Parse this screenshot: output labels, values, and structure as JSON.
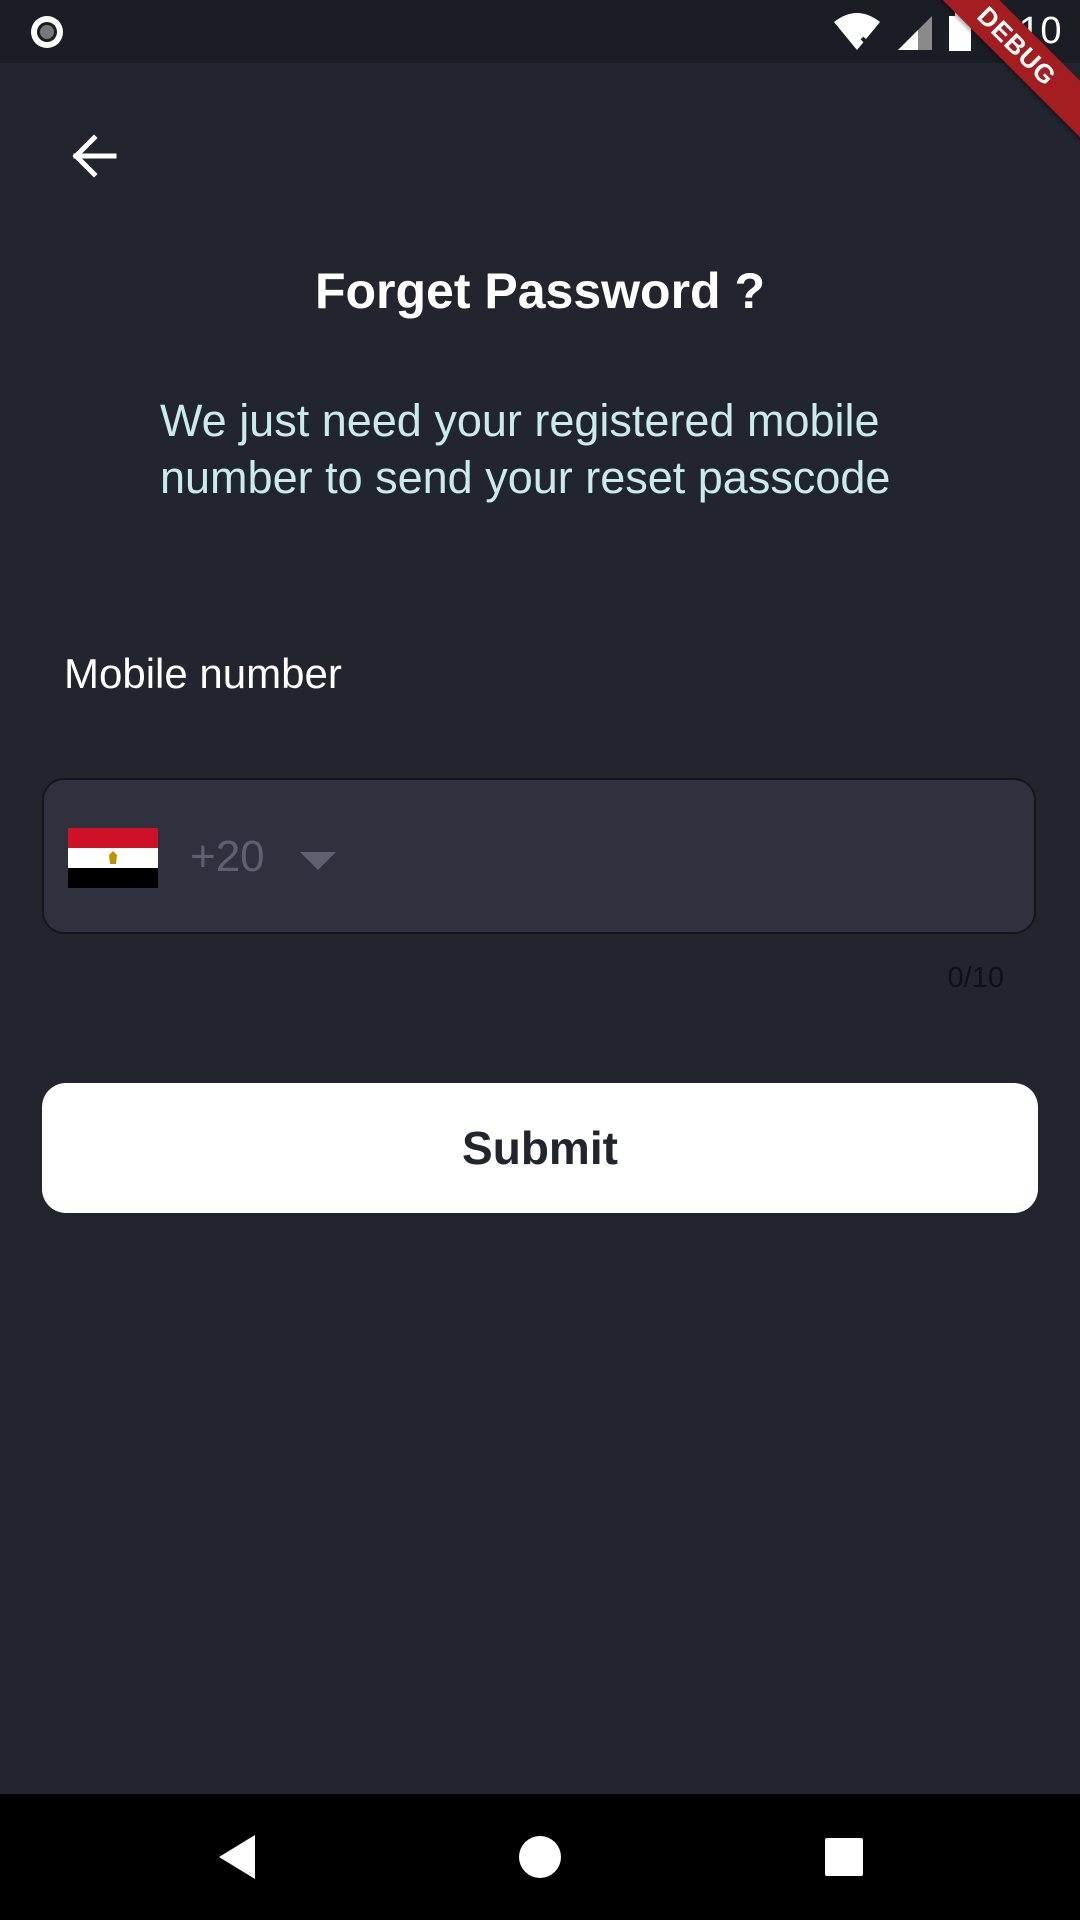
{
  "status_bar": {
    "time": "6:10",
    "icons": [
      "record-icon",
      "wifi-icon",
      "signal-icon",
      "battery-icon"
    ]
  },
  "debug_banner": "DEBUG",
  "nav": {
    "back_icon": "arrow-left-icon"
  },
  "title": "Forget Password ?",
  "subtitle": "We just need your registered mobile number to send your reset passcode",
  "form": {
    "label": "Mobile number",
    "country_flag": "egypt-flag",
    "country_code": "+20",
    "value": "",
    "counter": "0/10"
  },
  "submit_label": "Submit",
  "system_nav": {
    "icons": [
      "back-triangle-icon",
      "home-circle-icon",
      "recents-square-icon"
    ]
  },
  "colors": {
    "background": "#23252e",
    "field_background": "#30313f",
    "subtitle_text": "#c9ecea",
    "button_background": "#ffffff",
    "debug_banner": "#a41d20"
  }
}
